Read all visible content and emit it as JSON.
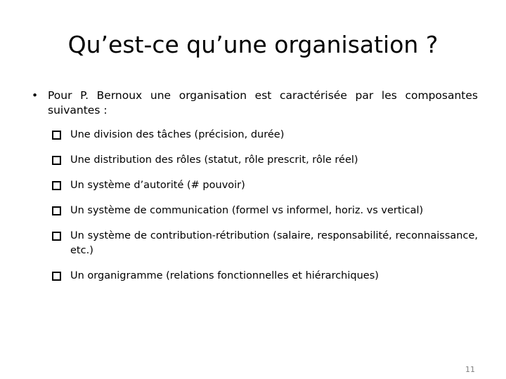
{
  "slide": {
    "title": "Qu’est-ce qu’une organisation ?",
    "page_number": "11",
    "text_color": "#000000",
    "page_number_color": "#808080",
    "background_color": "#ffffff"
  },
  "body": {
    "lead_bullet": {
      "marker": "•",
      "text": "Pour P. Bernoux une organisation est caractérisée par les composantes suivantes :"
    },
    "sub_bullets": [
      {
        "marker": "❑",
        "text": "Une division des tâches (précision, durée)"
      },
      {
        "marker": "❑",
        "text": "Une distribution des rôles (statut, rôle prescrit, rôle réel)"
      },
      {
        "marker": "❑",
        "text": "Un système d’autorité (# pouvoir)"
      },
      {
        "marker": "❑",
        "text": "Un système de communication (formel vs informel, horiz. vs vertical)"
      },
      {
        "marker": "❑",
        "text": "Un système de contribution-rétribution (salaire, responsabilité, reconnaissance, etc.)"
      },
      {
        "marker": "❑",
        "text": "Un organigramme (relations fonctionnelles et hiérarchiques)"
      }
    ]
  }
}
